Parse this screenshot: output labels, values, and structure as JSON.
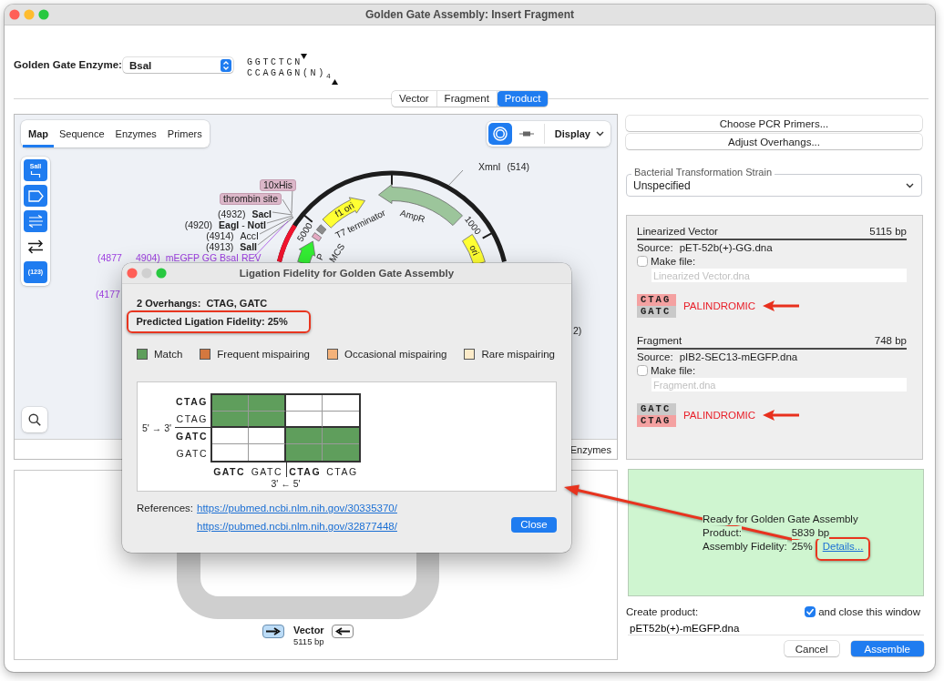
{
  "window": {
    "title": "Golden Gate Assembly: Insert Fragment",
    "controls": [
      {
        "kind": "close",
        "disabled": false
      },
      {
        "kind": "minimize",
        "disabled": false
      },
      {
        "kind": "zoom",
        "disabled": false
      }
    ]
  },
  "enzyme": {
    "label": "Golden Gate Enzyme:",
    "value": "BsaI",
    "site_top": "GGTCTCN",
    "site_bottom": "CCAGAGN(N)$_{4}$"
  },
  "view_tabs": [
    {
      "label": "Vector",
      "selected": false
    },
    {
      "label": "Fragment",
      "selected": false
    },
    {
      "label": "Product",
      "selected": true
    }
  ],
  "map_panel": {
    "tabs": [
      {
        "label": "Map",
        "selected": true
      },
      {
        "label": "Sequence",
        "selected": false
      },
      {
        "label": "Enzymes",
        "selected": false
      },
      {
        "label": "Primers",
        "selected": false
      }
    ],
    "view_buttons": [
      {
        "kind": "circular",
        "selected": true
      },
      {
        "kind": "linear",
        "selected": false
      }
    ],
    "display_menu": "Display",
    "tools": [
      {
        "kind": "enzymes",
        "label": "SalI",
        "on": true
      },
      {
        "kind": "features",
        "on": true
      },
      {
        "kind": "primers",
        "on": true
      },
      {
        "kind": "orientation",
        "on": false
      },
      {
        "kind": "numbers",
        "label": "(123)",
        "on": true
      }
    ],
    "map": {
      "ticks": [
        {
          "label": "1000"
        },
        {
          "label": "5000"
        }
      ],
      "features": [
        {
          "name": "f1 ori",
          "color": "#ffff33",
          "pointed": true,
          "reverse": false
        },
        {
          "name": "AmpR",
          "color": "#9cc59b",
          "pointed": true,
          "reverse": true
        },
        {
          "name": "ori",
          "color": "#ffff33",
          "pointed": false
        },
        {
          "name": "T7 terminator",
          "color": "#8c8c8c",
          "pointed": false
        },
        {
          "name": "MCS",
          "color": "#e4a9c2",
          "pointed": false
        },
        {
          "name": "P",
          "color": "#33ee33",
          "pointed": true,
          "reverse": false
        }
      ],
      "tags": [
        {
          "label": "10xHis"
        },
        {
          "label": "thrombin site"
        }
      ],
      "sites": [
        {
          "name": "XmnI",
          "position": "(514)",
          "bold": false
        },
        {
          "name": "SacI",
          "position": "(4932)",
          "bold": true
        },
        {
          "name": "**EagI** - **NotI**",
          "position": "(4920)",
          "bold": false
        },
        {
          "name": "AccI",
          "position": "(4914)",
          "bold": false
        },
        {
          "name": "SalI",
          "position": "(4913)",
          "bold": true
        }
      ],
      "primers": [
        {
          "texts": [
            "(4877",
            "4904)  mEGFP GG BsaI REV"
          ]
        },
        {
          "texts": [
            "(4177"
          ]
        }
      ],
      "partial_labels": [
        "2)"
      ]
    },
    "bottom_tabs": [
      {
        "label": "Enzymes"
      }
    ]
  },
  "construct": {
    "name": "Vector",
    "size": "5115 bp",
    "direction_buttons": [
      {
        "kind": "forward",
        "selected": true
      },
      {
        "kind": "reverse",
        "selected": false
      }
    ]
  },
  "side_panel": {
    "buttons": [
      "Choose PCR Primers...",
      "Adjust Overhangs..."
    ],
    "strain": {
      "label": "Bacterial Transformation Strain",
      "value": "Unspecified"
    },
    "parts": [
      {
        "title": "Linearized Vector",
        "size": "5115 bp",
        "source_label": "Source:",
        "source": "pET-52b(+)-GG.dna",
        "make_file_label": "Make file:",
        "make_file": false,
        "file": {
          "placeholder": "Linearized Vector.dna"
        },
        "overhang": [
          {
            "bases": "CTAG",
            "highlighted": true
          },
          {
            "bases": "GATC",
            "highlighted": false
          }
        ],
        "warning": "PALINDROMIC",
        "flagged": true
      },
      {
        "title": "Fragment",
        "size": "748 bp",
        "source_label": "Source:",
        "source": "pIB2-SEC13-mEGFP.dna",
        "make_file_label": "Make file:",
        "make_file": false,
        "file": {
          "placeholder": "Fragment.dna"
        },
        "overhang": [
          {
            "bases": "GATC",
            "highlighted": false
          },
          {
            "bases": "CTAG",
            "highlighted": true
          }
        ],
        "warning": "PALINDROMIC",
        "flagged": true
      }
    ],
    "status": {
      "heading": "Ready for Golden Gate Assembly",
      "rows": [
        {
          "label": "Product:",
          "value": "5839 bp"
        },
        {
          "label": "Assembly Fidelity:",
          "value": "25%",
          "link": "Details...",
          "highlighted": true
        }
      ]
    },
    "create": {
      "label": "Create product:",
      "close_option": {
        "label": "and close this window",
        "checked": true
      },
      "filename": {
        "value": "pET52b(+)-mEGFP.dna"
      }
    },
    "actions": [
      {
        "label": "Cancel",
        "primary": false
      },
      {
        "label": "Assemble",
        "primary": true
      }
    ]
  },
  "dialog": {
    "title": "Ligation Fidelity for Golden Gate Assembly",
    "controls": [
      {
        "kind": "close",
        "disabled": false
      },
      {
        "kind": "minimize",
        "disabled": true
      },
      {
        "kind": "zoom",
        "disabled": false
      }
    ],
    "overhangs": "2 Overhangs:  CTAG, GATC",
    "fidelity": {
      "text": "Predicted Ligation Fidelity: 25%",
      "highlighted": true
    },
    "legend": [
      {
        "label": "Match",
        "color": "#5f9e5c"
      },
      {
        "label": "Frequent mispairing",
        "color": "#d4783f"
      },
      {
        "label": "Occasional mispairing",
        "color": "#f4b27a"
      },
      {
        "label": "Rare mispairing",
        "color": "#fcebc9"
      }
    ],
    "matrix": {
      "row_axis": "5' → 3'",
      "column_axis": "3' ← 5'",
      "rows": [
        {
          "label": "CTAG",
          "bold": true
        },
        {
          "label": "CTAG",
          "bold": false
        },
        {
          "label": "GATC",
          "bold": true
        },
        {
          "label": "GATC",
          "bold": false
        }
      ],
      "columns": [
        {
          "label": "GATC",
          "bold": true
        },
        {
          "label": "GATC",
          "bold": false
        },
        {
          "label": "CTAG",
          "bold": true
        },
        {
          "label": "CTAG",
          "bold": false
        }
      ],
      "matches": [
        [
          true,
          true,
          false,
          false
        ],
        [
          true,
          true,
          false,
          false
        ],
        [
          false,
          false,
          true,
          true
        ],
        [
          false,
          false,
          true,
          true
        ]
      ]
    },
    "references_label": "References:",
    "references": [
      "https://pubmed.ncbi.nlm.nih.gov/30335370/",
      "https://pubmed.ncbi.nlm.nih.gov/32877448/"
    ],
    "close_button": "Close"
  },
  "annotations": {
    "callout_arrow": true
  }
}
